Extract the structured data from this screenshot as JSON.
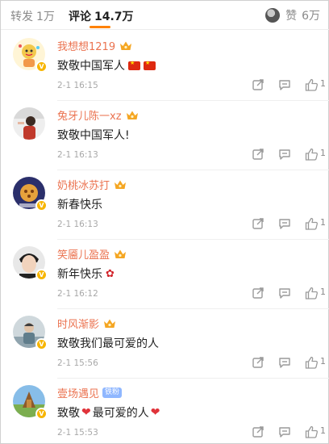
{
  "tabs": {
    "repost_label": "转发",
    "repost_count": "1万",
    "comment_label": "评论",
    "comment_count": "14.7万",
    "like_label": "赞",
    "like_count": "6万",
    "accent_color": "#ff8200"
  },
  "comments": [
    {
      "username": "我想想1219",
      "text": "致敬中国军人",
      "emoji": [
        "flag-china",
        "flag-china"
      ],
      "time": "2-1 16:15",
      "likes": "1",
      "badge": "crown"
    },
    {
      "username": "兔牙儿陈一xz",
      "text": "致敬中国军人!",
      "emoji": [],
      "time": "2-1 16:13",
      "likes": "1",
      "badge": "crown"
    },
    {
      "username": "奶桃冰苏打",
      "text": "新春快乐",
      "emoji": [],
      "time": "2-1 16:13",
      "likes": "1",
      "badge": "crown"
    },
    {
      "username": "笑靥儿盈盈",
      "text": "新年快乐",
      "emoji": [
        "rose"
      ],
      "time": "2-1 16:12",
      "likes": "1",
      "badge": "crown"
    },
    {
      "username": "时风渐影",
      "text": "致敬我们最可爱的人",
      "emoji": [],
      "time": "2-1 15:56",
      "likes": "1",
      "badge": "crown"
    },
    {
      "username": "壹场遇见",
      "text_before": "致敬",
      "text_after": "最可爱的人",
      "emoji": [
        "heart",
        "heart"
      ],
      "time": "2-1 15:53",
      "likes": "1",
      "badge": "fan",
      "fan_badge_label": "铁粉"
    }
  ]
}
